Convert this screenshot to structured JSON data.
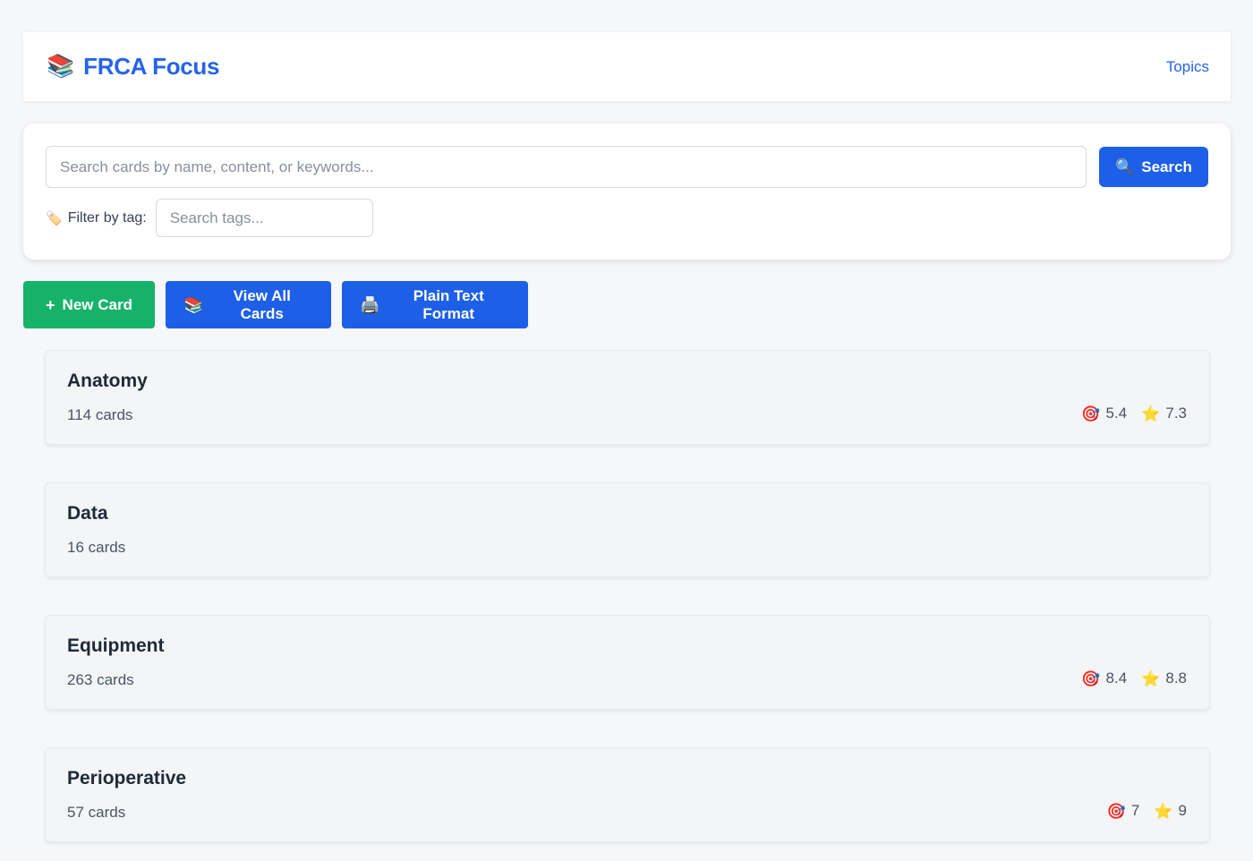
{
  "header": {
    "brand_icon": "📚",
    "title": "FRCA Focus",
    "nav_topics": "Topics"
  },
  "search": {
    "placeholder": "Search cards by name, content, or keywords...",
    "button_icon": "🔍",
    "button_label": "Search",
    "filter_icon": "🏷️",
    "filter_label": "Filter by tag:",
    "tag_placeholder": "Search tags..."
  },
  "actions": {
    "new_card_icon": "+",
    "new_card_label": "New Card",
    "view_all_icon": "📚",
    "view_all_label": "View All Cards",
    "plain_text_icon": "🖨️",
    "plain_text_label": "Plain Text Format"
  },
  "stat_icons": {
    "target": "🎯",
    "star": "⭐"
  },
  "topics": [
    {
      "name": "Anatomy",
      "count": "114 cards",
      "target": "5.4",
      "star": "7.3"
    },
    {
      "name": "Data",
      "count": "16 cards",
      "target": null,
      "star": null
    },
    {
      "name": "Equipment",
      "count": "263 cards",
      "target": "8.4",
      "star": "8.8"
    },
    {
      "name": "Perioperative",
      "count": "57 cards",
      "target": "7",
      "star": "9"
    }
  ],
  "colors": {
    "brand": "#2563eb",
    "primary_button": "#1d5fe6",
    "success_button": "#17b26a",
    "background": "#f5f7fa"
  }
}
